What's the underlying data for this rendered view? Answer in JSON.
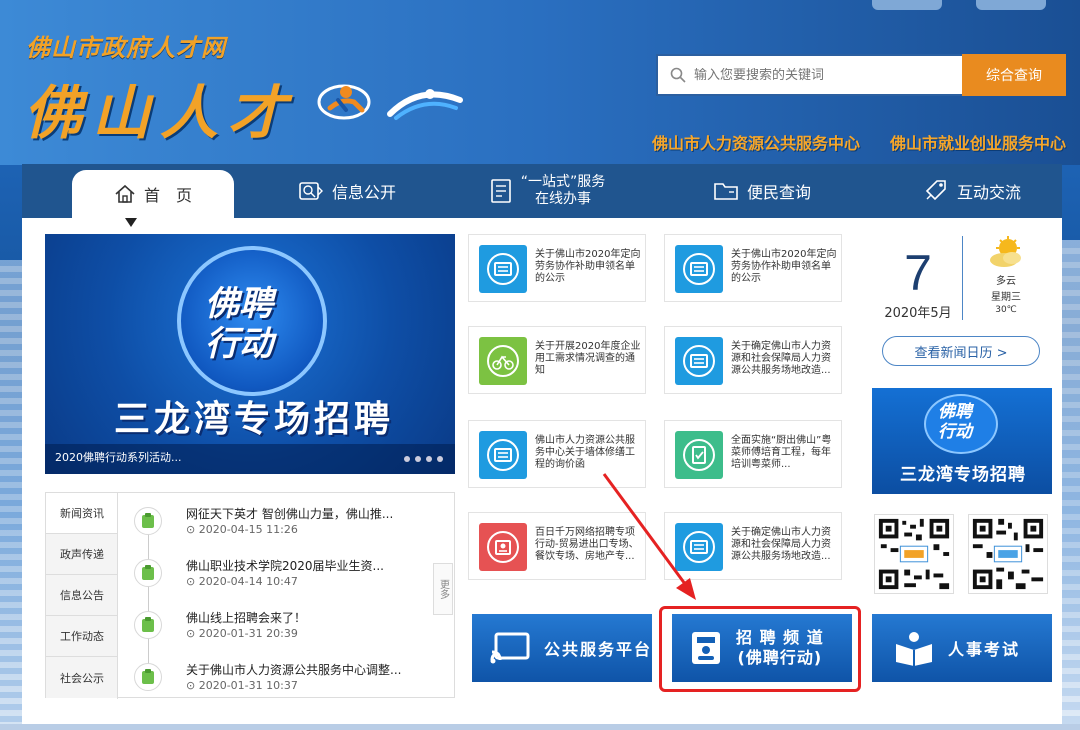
{
  "header": {
    "site_small": "佛山市政府人才网",
    "site_big": "佛山人才",
    "search_placeholder": "输入您要搜索的关键词",
    "search_button": "综合查询",
    "org_links": [
      "佛山市人力资源公共服务中心",
      "佛山市就业创业服务中心"
    ]
  },
  "nav": {
    "items": [
      {
        "label": "首　页",
        "icon": "home-icon"
      },
      {
        "label": "信息公开",
        "icon": "info-icon"
      },
      {
        "label_line1": "“一站式”服务",
        "label_line2": "在线办事",
        "icon": "document-icon"
      },
      {
        "label": "便民查询",
        "icon": "folder-icon"
      },
      {
        "label": "互动交流",
        "icon": "tag-icon"
      }
    ]
  },
  "banner": {
    "emblem_line1": "佛聘",
    "emblem_line2": "行动",
    "slogan": "三龙湾专场招聘",
    "caption": "2020佛聘行动系列活动..."
  },
  "news": {
    "tabs": [
      "新闻资讯",
      "政声传递",
      "信息公告",
      "工作动态",
      "社会公示"
    ],
    "items": [
      {
        "title": "网征天下英才 智创佛山力量，佛山推...",
        "date": "2020-04-15 11:26"
      },
      {
        "title": "佛山职业技术学院2020届毕业生资...",
        "date": "2020-04-14 10:47"
      },
      {
        "title": "佛山线上招聘会来了！",
        "date": "2020-01-31 20:39"
      },
      {
        "title": "关于佛山市人力资源公共服务中心调整...",
        "date": "2020-01-31 10:37"
      }
    ],
    "more": "更多"
  },
  "cards": [
    {
      "text": "关于佛山市2020年定向劳务协作补助申领名单的公示",
      "color": "#1f9be0",
      "icon": "id-card-icon"
    },
    {
      "text": "关于佛山市2020年定向劳务协作补助申领名单的公示",
      "color": "#1f9be0",
      "icon": "id-card-icon"
    },
    {
      "text": "关于开展2020年度企业用工需求情况调查的通知",
      "color": "#7cc242",
      "icon": "bike-icon"
    },
    {
      "text": "关于确定佛山市人力资源和社会保障局人力资源公共服务场地改造...",
      "color": "#1f9be0",
      "icon": "id-card-icon"
    },
    {
      "text": "佛山市人力资源公共服务中心关于墙体修缮工程的询价函",
      "color": "#1f9be0",
      "icon": "id-card-icon"
    },
    {
      "text": "全面实施“厨出佛山”粤菜师傅培育工程，每年培训粤菜师...",
      "color": "#3dbd8b",
      "icon": "clipboard-icon"
    },
    {
      "text": "百日千万网络招聘专项行动-贸易进出口专场、餐饮专场、房地产专...",
      "color": "#e65253",
      "icon": "recruit-icon"
    },
    {
      "text": "关于确定佛山市人力资源和社会保障局人力资源公共服务场地改造...",
      "color": "#1f9be0",
      "icon": "id-card-icon"
    }
  ],
  "calendar": {
    "day": "7",
    "year_month": "2020年5月",
    "weather": "多云",
    "weekday": "星期三",
    "temperature": "30℃",
    "button": "查看新闻日历 >"
  },
  "mini_banner": {
    "line1": "佛聘",
    "line2": "行动",
    "slogan": "三龙湾专场招聘"
  },
  "bottom_buttons": {
    "public_service": "公共服务平台",
    "recruit_line1": "招 聘 频 道",
    "recruit_line2": "(佛聘行动)",
    "exam": "人事考试"
  }
}
